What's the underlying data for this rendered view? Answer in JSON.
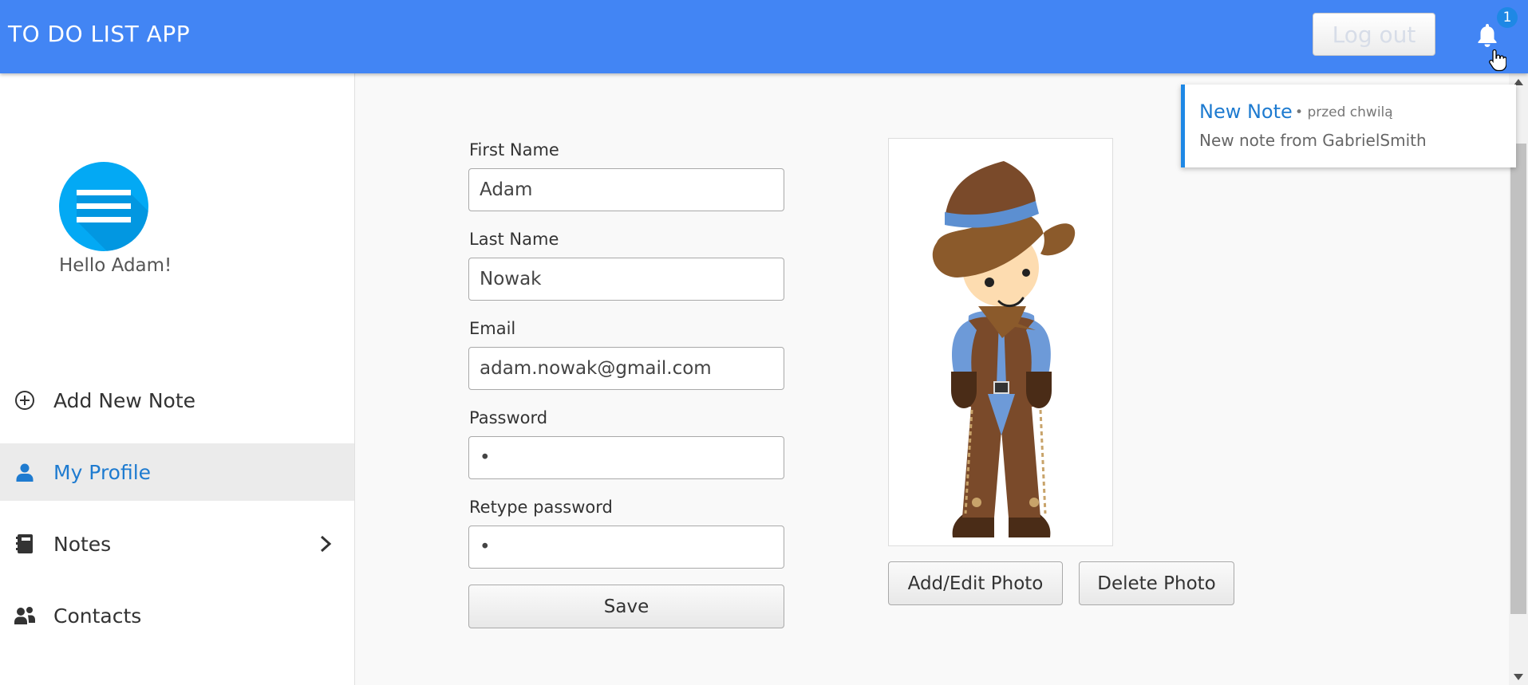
{
  "header": {
    "app_title": "TO DO LIST APP",
    "logout_label": "Log out",
    "notification_count": "1",
    "bell_icon": "bell-icon"
  },
  "sidebar": {
    "avatar_icon": "hamburger-menu-icon",
    "greeting": "Hello Adam!",
    "items": [
      {
        "label": "Add New Note",
        "icon": "plus-circle-icon",
        "active": false
      },
      {
        "label": "My Profile",
        "icon": "user-icon",
        "active": true
      },
      {
        "label": "Notes",
        "icon": "notebook-icon",
        "active": false,
        "has_chevron": true
      },
      {
        "label": "Contacts",
        "icon": "contacts-icon",
        "active": false
      }
    ]
  },
  "form": {
    "first_name": {
      "label": "First Name",
      "value": "Adam"
    },
    "last_name": {
      "label": "Last Name",
      "value": "Nowak"
    },
    "email": {
      "label": "Email",
      "value": "adam.nowak@gmail.com"
    },
    "password": {
      "label": "Password",
      "value": "•"
    },
    "retype_password": {
      "label": "Retype password",
      "value": "•"
    },
    "save_label": "Save"
  },
  "photo": {
    "image": "cowboy-avatar-illustration",
    "add_edit_label": "Add/Edit Photo",
    "delete_label": "Delete Photo"
  },
  "notification": {
    "title": "New Note",
    "separator": "•",
    "time": "przed chwilą",
    "body": "New note from GabrielSmith"
  },
  "colors": {
    "primary": "#4285f4",
    "accent": "#1e7bd0",
    "avatar_bg": "#03a9f4"
  }
}
